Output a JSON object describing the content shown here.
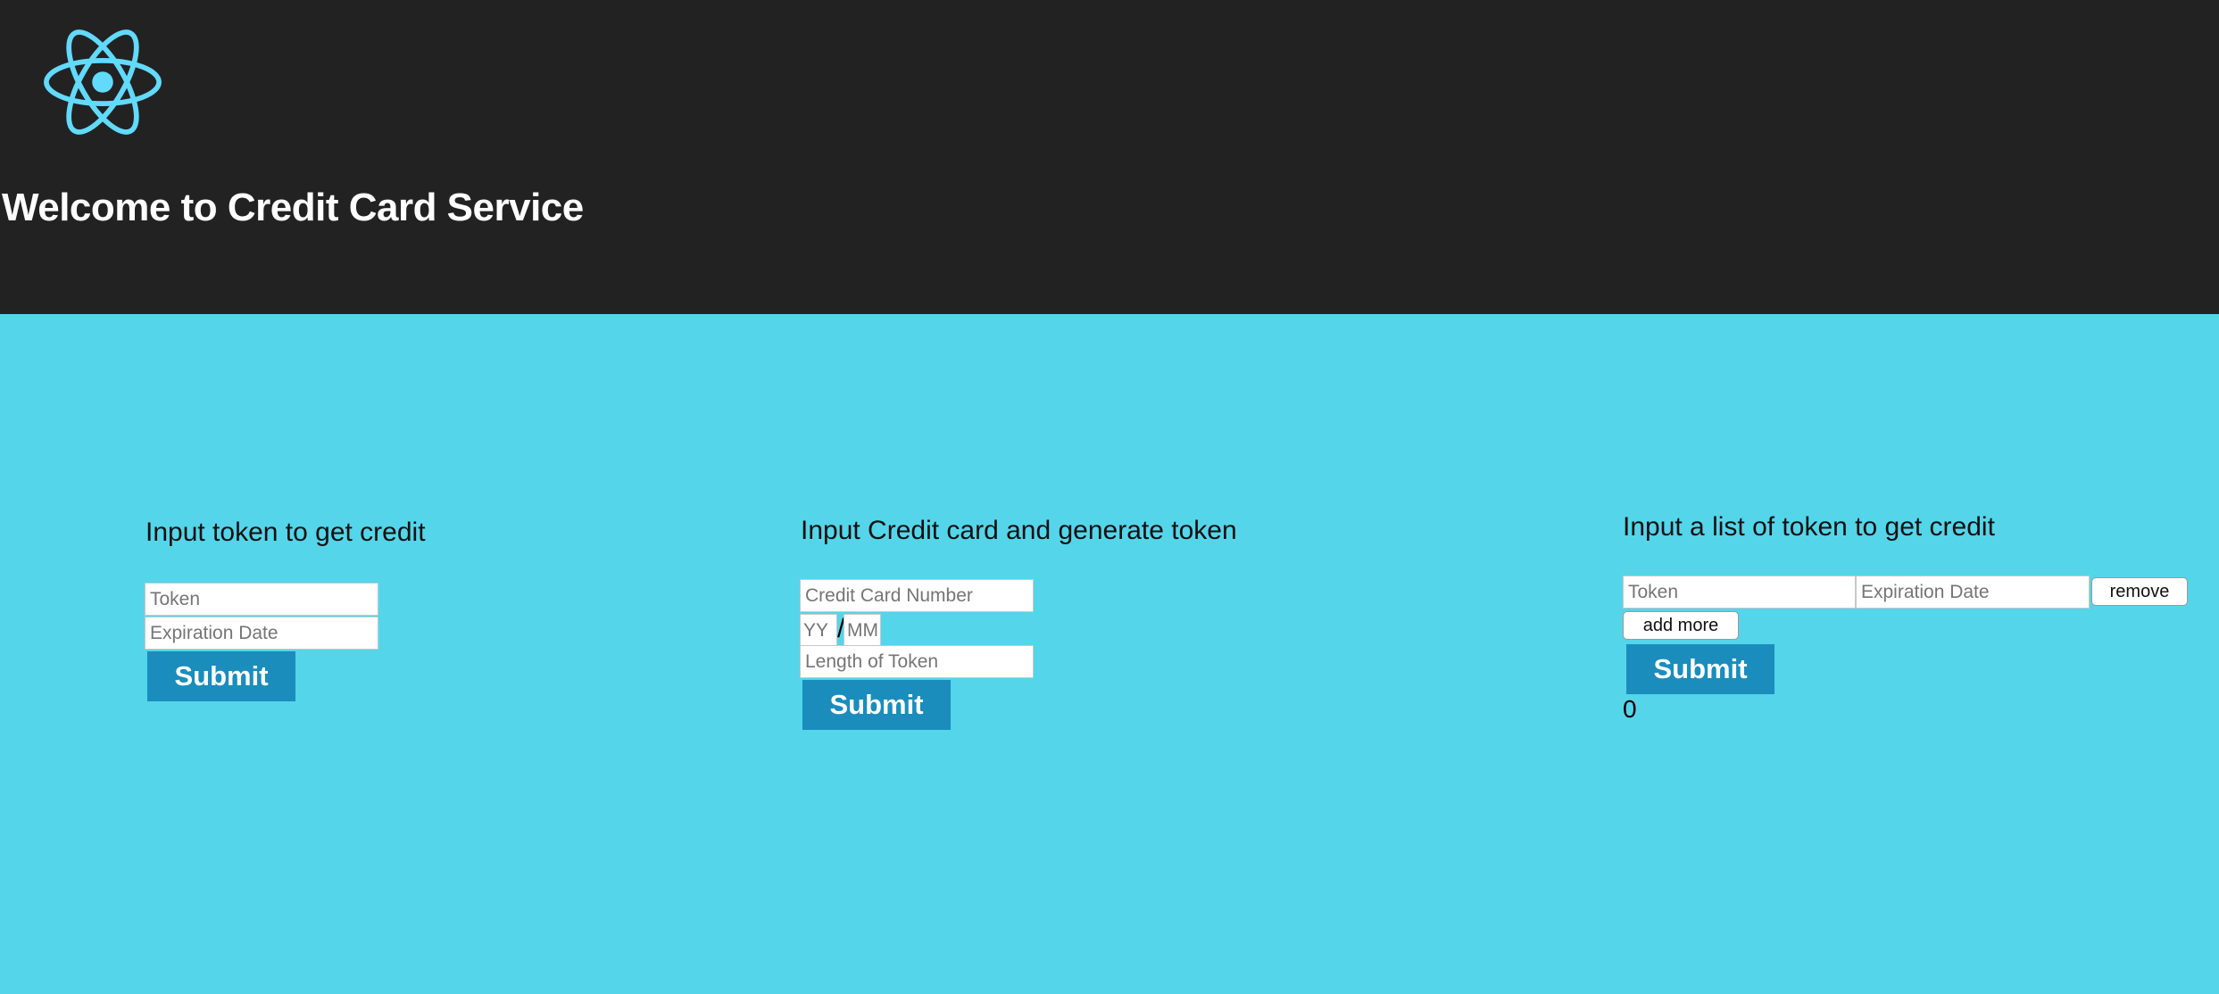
{
  "header": {
    "title": "Welcome to Credit Card Service",
    "logo_icon": "react-atom-icon",
    "logo_color": "#61dafb",
    "background": "#222222"
  },
  "colors": {
    "page_background": "#54d5ea",
    "button_background": "#1a8dbd",
    "button_text": "#ffffff"
  },
  "panel_get_credit": {
    "heading": "Input token to get credit",
    "token_placeholder": "Token",
    "expiration_placeholder": "Expiration Date",
    "submit_label": "Submit"
  },
  "panel_generate_token": {
    "heading": "Input Credit card and generate token",
    "card_number_placeholder": "Credit Card Number",
    "year_placeholder": "YY",
    "date_separator": "/",
    "month_placeholder": "MM",
    "token_length_placeholder": "Length of Token",
    "submit_label": "Submit"
  },
  "panel_token_list": {
    "heading": "Input a list of token to get credit",
    "rows": [
      {
        "token_placeholder": "Token",
        "expiration_placeholder": "Expiration Date",
        "remove_label": "remove"
      }
    ],
    "add_more_label": "add more",
    "submit_label": "Submit",
    "result_value": "0"
  }
}
